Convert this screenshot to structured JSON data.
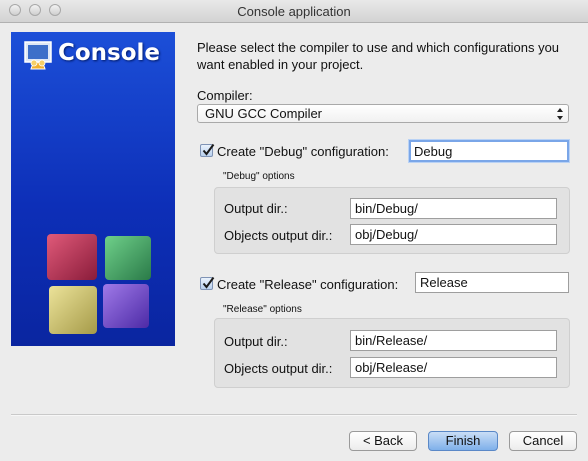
{
  "window": {
    "title": "Console application"
  },
  "banner": {
    "title": "Console"
  },
  "intro": "Please select the compiler to use and which configurations you want enabled in your project.",
  "compiler": {
    "label": "Compiler:",
    "value": "GNU GCC Compiler"
  },
  "debug": {
    "checkbox_label": "Create \"Debug\" configuration:",
    "checked": true,
    "name": "Debug",
    "options_label": "\"Debug\" options",
    "output_dir_label": "Output dir.:",
    "output_dir": "bin/Debug/",
    "objects_dir_label": "Objects output dir.:",
    "objects_dir": "obj/Debug/"
  },
  "release": {
    "checkbox_label": "Create \"Release\" configuration:",
    "checked": true,
    "name": "Release",
    "options_label": "\"Release\" options",
    "output_dir_label": "Output dir.:",
    "output_dir": "bin/Release/",
    "objects_dir_label": "Objects output dir.:",
    "objects_dir": "obj/Release/"
  },
  "buttons": {
    "back": "< Back",
    "finish": "Finish",
    "cancel": "Cancel"
  },
  "colors": {
    "banner": "#1c4fd8",
    "focus": "#7aa6e8",
    "default_button": "#7fb0ea"
  }
}
